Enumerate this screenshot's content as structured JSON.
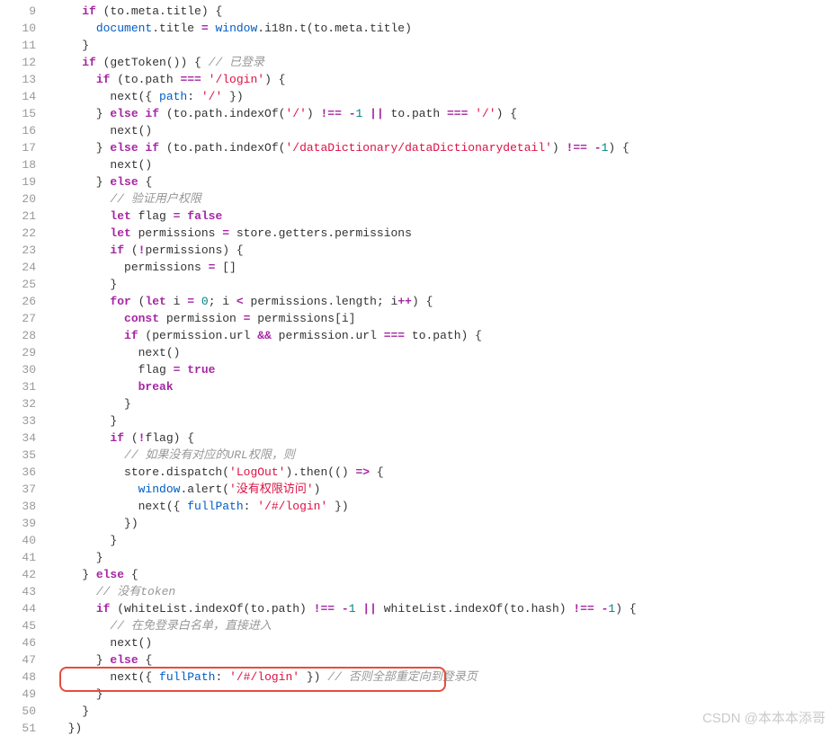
{
  "watermark": "CSDN @本本本添哥",
  "lines": [
    {
      "n": 9,
      "seg": [
        {
          "c": "plain",
          "t": "    "
        },
        {
          "c": "kw",
          "t": "if"
        },
        {
          "c": "plain",
          "t": " (to.meta.title) {"
        }
      ]
    },
    {
      "n": 10,
      "seg": [
        {
          "c": "plain",
          "t": "      "
        },
        {
          "c": "obj",
          "t": "document"
        },
        {
          "c": "plain",
          "t": ".title "
        },
        {
          "c": "op",
          "t": "="
        },
        {
          "c": "plain",
          "t": " "
        },
        {
          "c": "obj",
          "t": "window"
        },
        {
          "c": "plain",
          "t": ".i18n.t(to.meta.title)"
        }
      ]
    },
    {
      "n": 11,
      "seg": [
        {
          "c": "plain",
          "t": "    }"
        }
      ]
    },
    {
      "n": 12,
      "seg": [
        {
          "c": "plain",
          "t": "    "
        },
        {
          "c": "kw",
          "t": "if"
        },
        {
          "c": "plain",
          "t": " (getToken()) { "
        },
        {
          "c": "cmt",
          "t": "// 已登录"
        }
      ]
    },
    {
      "n": 13,
      "seg": [
        {
          "c": "plain",
          "t": "      "
        },
        {
          "c": "kw",
          "t": "if"
        },
        {
          "c": "plain",
          "t": " (to.path "
        },
        {
          "c": "op",
          "t": "==="
        },
        {
          "c": "plain",
          "t": " "
        },
        {
          "c": "str",
          "t": "'/login'"
        },
        {
          "c": "plain",
          "t": ") {"
        }
      ]
    },
    {
      "n": 14,
      "seg": [
        {
          "c": "plain",
          "t": "        next({ "
        },
        {
          "c": "prop",
          "t": "path"
        },
        {
          "c": "plain",
          "t": ": "
        },
        {
          "c": "str",
          "t": "'/'"
        },
        {
          "c": "plain",
          "t": " })"
        }
      ]
    },
    {
      "n": 15,
      "seg": [
        {
          "c": "plain",
          "t": "      } "
        },
        {
          "c": "kw",
          "t": "else if"
        },
        {
          "c": "plain",
          "t": " (to.path.indexOf("
        },
        {
          "c": "str",
          "t": "'/'"
        },
        {
          "c": "plain",
          "t": ") "
        },
        {
          "c": "op",
          "t": "!=="
        },
        {
          "c": "plain",
          "t": " "
        },
        {
          "c": "op",
          "t": "-"
        },
        {
          "c": "num",
          "t": "1"
        },
        {
          "c": "plain",
          "t": " "
        },
        {
          "c": "op",
          "t": "||"
        },
        {
          "c": "plain",
          "t": " to.path "
        },
        {
          "c": "op",
          "t": "==="
        },
        {
          "c": "plain",
          "t": " "
        },
        {
          "c": "str",
          "t": "'/'"
        },
        {
          "c": "plain",
          "t": ") {"
        }
      ]
    },
    {
      "n": 16,
      "seg": [
        {
          "c": "plain",
          "t": "        next()"
        }
      ]
    },
    {
      "n": 17,
      "seg": [
        {
          "c": "plain",
          "t": "      } "
        },
        {
          "c": "kw",
          "t": "else if"
        },
        {
          "c": "plain",
          "t": " (to.path.indexOf("
        },
        {
          "c": "str",
          "t": "'/dataDictionary/dataDictionarydetail'"
        },
        {
          "c": "plain",
          "t": ") "
        },
        {
          "c": "op",
          "t": "!=="
        },
        {
          "c": "plain",
          "t": " "
        },
        {
          "c": "op",
          "t": "-"
        },
        {
          "c": "num",
          "t": "1"
        },
        {
          "c": "plain",
          "t": ") {"
        }
      ]
    },
    {
      "n": 18,
      "seg": [
        {
          "c": "plain",
          "t": "        next()"
        }
      ]
    },
    {
      "n": 19,
      "seg": [
        {
          "c": "plain",
          "t": "      } "
        },
        {
          "c": "kw",
          "t": "else"
        },
        {
          "c": "plain",
          "t": " {"
        }
      ]
    },
    {
      "n": 20,
      "seg": [
        {
          "c": "plain",
          "t": "        "
        },
        {
          "c": "cmt",
          "t": "// 验证用户权限"
        }
      ]
    },
    {
      "n": 21,
      "seg": [
        {
          "c": "plain",
          "t": "        "
        },
        {
          "c": "kw",
          "t": "let"
        },
        {
          "c": "plain",
          "t": " flag "
        },
        {
          "c": "op",
          "t": "="
        },
        {
          "c": "plain",
          "t": " "
        },
        {
          "c": "bool",
          "t": "false"
        }
      ]
    },
    {
      "n": 22,
      "seg": [
        {
          "c": "plain",
          "t": "        "
        },
        {
          "c": "kw",
          "t": "let"
        },
        {
          "c": "plain",
          "t": " permissions "
        },
        {
          "c": "op",
          "t": "="
        },
        {
          "c": "plain",
          "t": " store.getters.permissions"
        }
      ]
    },
    {
      "n": 23,
      "seg": [
        {
          "c": "plain",
          "t": "        "
        },
        {
          "c": "kw",
          "t": "if"
        },
        {
          "c": "plain",
          "t": " ("
        },
        {
          "c": "op",
          "t": "!"
        },
        {
          "c": "plain",
          "t": "permissions) {"
        }
      ]
    },
    {
      "n": 24,
      "seg": [
        {
          "c": "plain",
          "t": "          permissions "
        },
        {
          "c": "op",
          "t": "="
        },
        {
          "c": "plain",
          "t": " []"
        }
      ]
    },
    {
      "n": 25,
      "seg": [
        {
          "c": "plain",
          "t": "        }"
        }
      ]
    },
    {
      "n": 26,
      "seg": [
        {
          "c": "plain",
          "t": "        "
        },
        {
          "c": "kw",
          "t": "for"
        },
        {
          "c": "plain",
          "t": " ("
        },
        {
          "c": "kw",
          "t": "let"
        },
        {
          "c": "plain",
          "t": " i "
        },
        {
          "c": "op",
          "t": "="
        },
        {
          "c": "plain",
          "t": " "
        },
        {
          "c": "num",
          "t": "0"
        },
        {
          "c": "plain",
          "t": "; i "
        },
        {
          "c": "op",
          "t": "<"
        },
        {
          "c": "plain",
          "t": " permissions.length; i"
        },
        {
          "c": "op",
          "t": "++"
        },
        {
          "c": "plain",
          "t": ") {"
        }
      ]
    },
    {
      "n": 27,
      "seg": [
        {
          "c": "plain",
          "t": "          "
        },
        {
          "c": "kw",
          "t": "const"
        },
        {
          "c": "plain",
          "t": " permission "
        },
        {
          "c": "op",
          "t": "="
        },
        {
          "c": "plain",
          "t": " permissions[i]"
        }
      ]
    },
    {
      "n": 28,
      "seg": [
        {
          "c": "plain",
          "t": "          "
        },
        {
          "c": "kw",
          "t": "if"
        },
        {
          "c": "plain",
          "t": " (permission.url "
        },
        {
          "c": "op",
          "t": "&&"
        },
        {
          "c": "plain",
          "t": " permission.url "
        },
        {
          "c": "op",
          "t": "==="
        },
        {
          "c": "plain",
          "t": " to.path) {"
        }
      ]
    },
    {
      "n": 29,
      "seg": [
        {
          "c": "plain",
          "t": "            next()"
        }
      ]
    },
    {
      "n": 30,
      "seg": [
        {
          "c": "plain",
          "t": "            flag "
        },
        {
          "c": "op",
          "t": "="
        },
        {
          "c": "plain",
          "t": " "
        },
        {
          "c": "bool",
          "t": "true"
        }
      ]
    },
    {
      "n": 31,
      "seg": [
        {
          "c": "plain",
          "t": "            "
        },
        {
          "c": "kw",
          "t": "break"
        }
      ]
    },
    {
      "n": 32,
      "seg": [
        {
          "c": "plain",
          "t": "          }"
        }
      ]
    },
    {
      "n": 33,
      "seg": [
        {
          "c": "plain",
          "t": "        }"
        }
      ]
    },
    {
      "n": 34,
      "seg": [
        {
          "c": "plain",
          "t": "        "
        },
        {
          "c": "kw",
          "t": "if"
        },
        {
          "c": "plain",
          "t": " ("
        },
        {
          "c": "op",
          "t": "!"
        },
        {
          "c": "plain",
          "t": "flag) {"
        }
      ]
    },
    {
      "n": 35,
      "seg": [
        {
          "c": "plain",
          "t": "          "
        },
        {
          "c": "cmt",
          "t": "// 如果没有对应的URL权限，则"
        }
      ]
    },
    {
      "n": 36,
      "seg": [
        {
          "c": "plain",
          "t": "          store.dispatch("
        },
        {
          "c": "str",
          "t": "'LogOut'"
        },
        {
          "c": "plain",
          "t": ").then(() "
        },
        {
          "c": "op",
          "t": "=>"
        },
        {
          "c": "plain",
          "t": " {"
        }
      ]
    },
    {
      "n": 37,
      "seg": [
        {
          "c": "plain",
          "t": "            "
        },
        {
          "c": "obj",
          "t": "window"
        },
        {
          "c": "plain",
          "t": ".alert("
        },
        {
          "c": "str",
          "t": "'没有权限访问'"
        },
        {
          "c": "plain",
          "t": ")"
        }
      ]
    },
    {
      "n": 38,
      "seg": [
        {
          "c": "plain",
          "t": "            next({ "
        },
        {
          "c": "prop",
          "t": "fullPath"
        },
        {
          "c": "plain",
          "t": ": "
        },
        {
          "c": "str",
          "t": "'/#/login'"
        },
        {
          "c": "plain",
          "t": " })"
        }
      ]
    },
    {
      "n": 39,
      "seg": [
        {
          "c": "plain",
          "t": "          })"
        }
      ]
    },
    {
      "n": 40,
      "seg": [
        {
          "c": "plain",
          "t": "        }"
        }
      ]
    },
    {
      "n": 41,
      "seg": [
        {
          "c": "plain",
          "t": "      }"
        }
      ]
    },
    {
      "n": 42,
      "seg": [
        {
          "c": "plain",
          "t": "    } "
        },
        {
          "c": "kw",
          "t": "else"
        },
        {
          "c": "plain",
          "t": " {"
        }
      ]
    },
    {
      "n": 43,
      "seg": [
        {
          "c": "plain",
          "t": "      "
        },
        {
          "c": "cmt",
          "t": "// 没有token"
        }
      ]
    },
    {
      "n": 44,
      "seg": [
        {
          "c": "plain",
          "t": "      "
        },
        {
          "c": "kw",
          "t": "if"
        },
        {
          "c": "plain",
          "t": " (whiteList.indexOf(to.path) "
        },
        {
          "c": "op",
          "t": "!=="
        },
        {
          "c": "plain",
          "t": " "
        },
        {
          "c": "op",
          "t": "-"
        },
        {
          "c": "num",
          "t": "1"
        },
        {
          "c": "plain",
          "t": " "
        },
        {
          "c": "op",
          "t": "||"
        },
        {
          "c": "plain",
          "t": " whiteList.indexOf(to.hash) "
        },
        {
          "c": "op",
          "t": "!=="
        },
        {
          "c": "plain",
          "t": " "
        },
        {
          "c": "op",
          "t": "-"
        },
        {
          "c": "num",
          "t": "1"
        },
        {
          "c": "plain",
          "t": ") {"
        }
      ]
    },
    {
      "n": 45,
      "seg": [
        {
          "c": "plain",
          "t": "        "
        },
        {
          "c": "cmt",
          "t": "// 在免登录白名单，直接进入"
        }
      ]
    },
    {
      "n": 46,
      "seg": [
        {
          "c": "plain",
          "t": "        next()"
        }
      ]
    },
    {
      "n": 47,
      "seg": [
        {
          "c": "plain",
          "t": "      } "
        },
        {
          "c": "kw",
          "t": "else"
        },
        {
          "c": "plain",
          "t": " {"
        }
      ]
    },
    {
      "n": 48,
      "seg": [
        {
          "c": "plain",
          "t": "        next({ "
        },
        {
          "c": "prop",
          "t": "fullPath"
        },
        {
          "c": "plain",
          "t": ": "
        },
        {
          "c": "str",
          "t": "'/#/login'"
        },
        {
          "c": "plain",
          "t": " }) "
        },
        {
          "c": "cmt",
          "t": "// 否则全部重定向到登录页"
        }
      ]
    },
    {
      "n": 49,
      "seg": [
        {
          "c": "plain",
          "t": "      }"
        }
      ]
    },
    {
      "n": 50,
      "seg": [
        {
          "c": "plain",
          "t": "    }"
        }
      ]
    },
    {
      "n": 51,
      "seg": [
        {
          "c": "plain",
          "t": "  })"
        }
      ]
    }
  ]
}
